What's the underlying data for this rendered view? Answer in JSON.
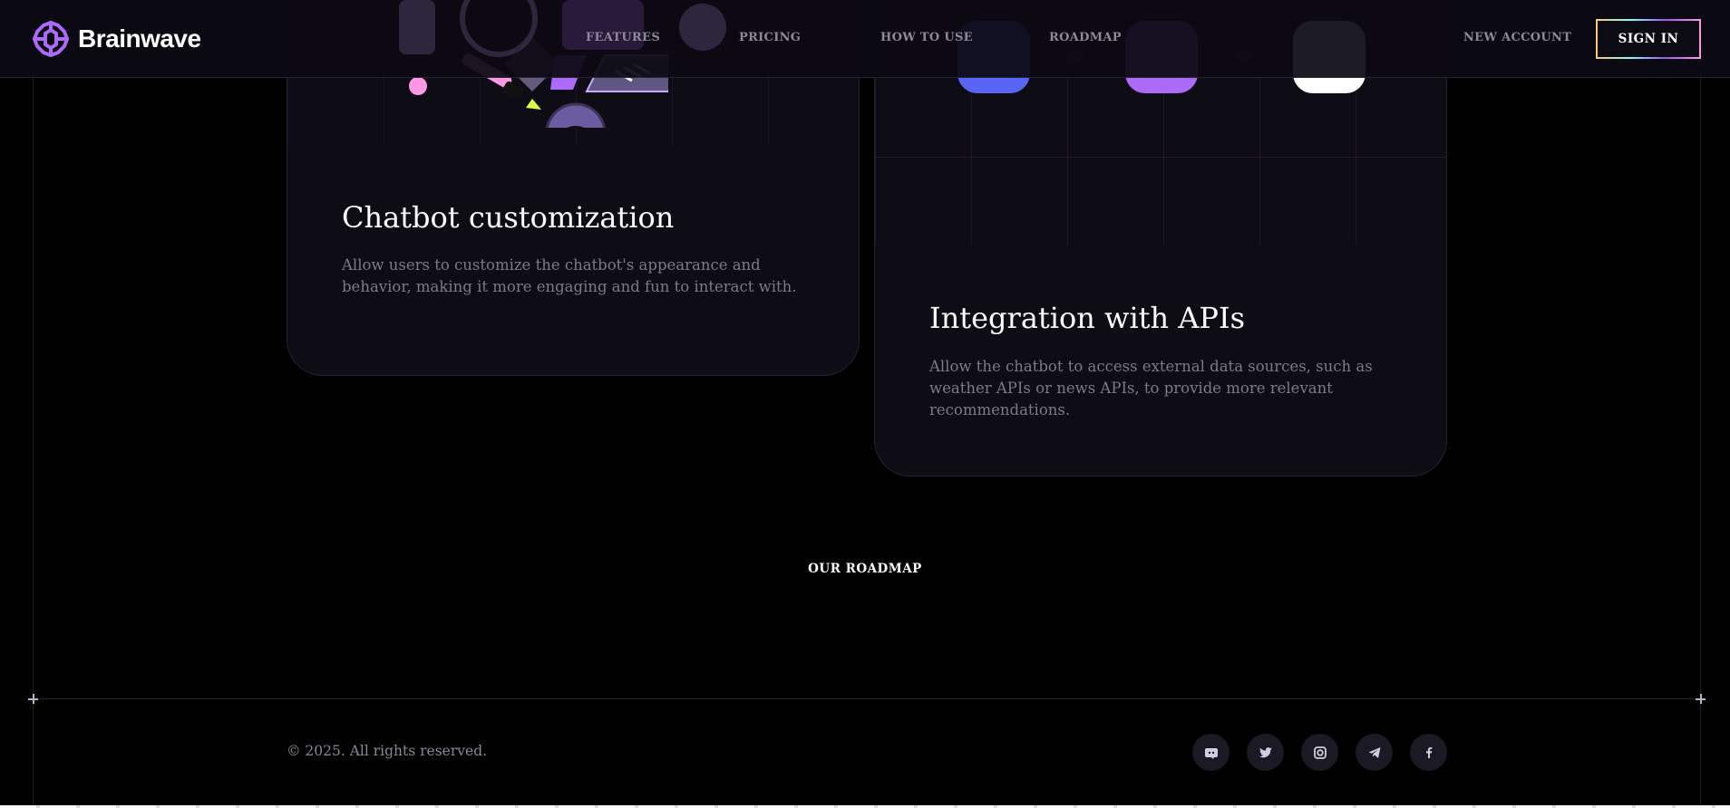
{
  "header": {
    "brand": "Brainwave",
    "nav": {
      "features": "FEATURES",
      "pricing": "PRICING",
      "how_to_use": "HOW TO USE",
      "roadmap": "ROADMAP"
    },
    "new_account": "NEW ACCOUNT",
    "sign_in": "SIGN IN"
  },
  "cards": {
    "customization": {
      "title": "Chatbot customization",
      "text": "Allow users to customize the chatbot's appearance and behavior, making it more engaging and fun to interact with."
    },
    "integration": {
      "title": "Integration with APIs",
      "text": "Allow the chatbot to access external data sources, such as weather APIs or news APIs, to provide more relevant recommendations."
    }
  },
  "section": {
    "roadmap_label": "OUR ROADMAP"
  },
  "footer": {
    "copyright": "© 2025. All rights reserved.",
    "socials": [
      "discord-icon",
      "twitter-icon",
      "instagram-icon",
      "telegram-icon",
      "facebook-icon"
    ]
  },
  "colors": {
    "background": "#000000",
    "card": "#0e0c15",
    "accent_purple": "#ac6af8",
    "discord_blue": "#5865f2",
    "muted_text": "#7d7a89"
  }
}
